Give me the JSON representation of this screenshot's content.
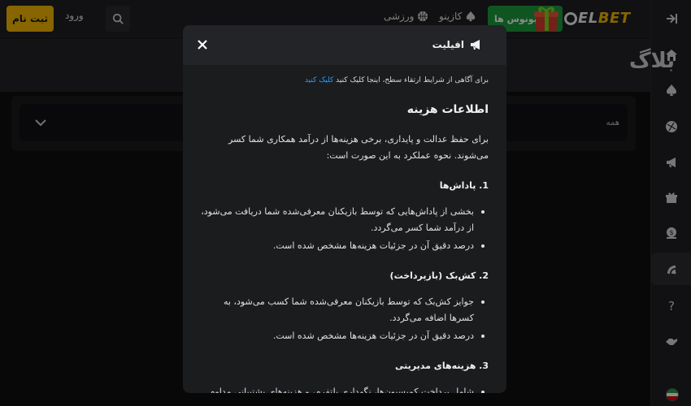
{
  "header": {
    "register_label": "ثبت نام",
    "login_label": "ورود",
    "nav": [
      {
        "label": "ورزشی",
        "icon": "basketball-icon"
      },
      {
        "label": "کازینو",
        "icon": "spade-icon"
      }
    ],
    "bonus_label": "بونوس ها",
    "logo": {
      "prefix": "EL",
      "suffix": "BET"
    }
  },
  "page": {
    "title": "بلاگ",
    "filter_label": "همه"
  },
  "sidebar": {
    "items": [
      {
        "name": "collapse-icon"
      },
      {
        "name": "home-icon"
      },
      {
        "name": "spade-icon"
      },
      {
        "name": "ball-icon"
      },
      {
        "name": "megaphone-icon"
      },
      {
        "name": "gift-icon"
      },
      {
        "name": "coin-icon"
      },
      {
        "name": "affiliate-icon"
      },
      {
        "name": "help-icon"
      },
      {
        "name": "handshake-icon"
      }
    ],
    "active_index": 7
  },
  "modal": {
    "title": "افیلیت",
    "notice_text": "برای آگاهی از شرایط ارتقاء سطح، اینجا کلیک کنید",
    "notice_link": "کلیک کنید",
    "heading": "اطلاعات هزینه",
    "intro": "برای حفظ عدالت و پایداری، برخی هزینه‌ها از درآمد همکاری شما کسر می‌شوند. نحوه عملکرد به این صورت است:",
    "sections": [
      {
        "title": "1. پاداش‌ها",
        "bullets": [
          "بخشی از پاداش‌هایی که توسط بازیکنان معرفی‌شده شما دریافت می‌شود، از درآمد شما کسر می‌گردد.",
          "درصد دقیق آن در جزئیات هزینه‌ها مشخص شده است."
        ]
      },
      {
        "title": "2. کش‌بک (بازپرداخت)",
        "bullets": [
          "جوایز کش‌بک که توسط بازیکنان معرفی‌شده شما کسب می‌شود، به کسرها اضافه می‌گردد.",
          "درصد دقیق آن در جزئیات هزینه‌ها مشخص شده است."
        ]
      },
      {
        "title": "3. هزینه‌های مدیریتی",
        "bullets": [
          "شامل پرداخت کمیسیون‌ها، نگهداری پلتفرم، و هزینه‌های پشتیبانی مداوم"
        ]
      }
    ]
  },
  "colors": {
    "accent": "#f6b800",
    "bonus_green": "#1d9b3c",
    "link_blue": "#1ea1ff"
  }
}
